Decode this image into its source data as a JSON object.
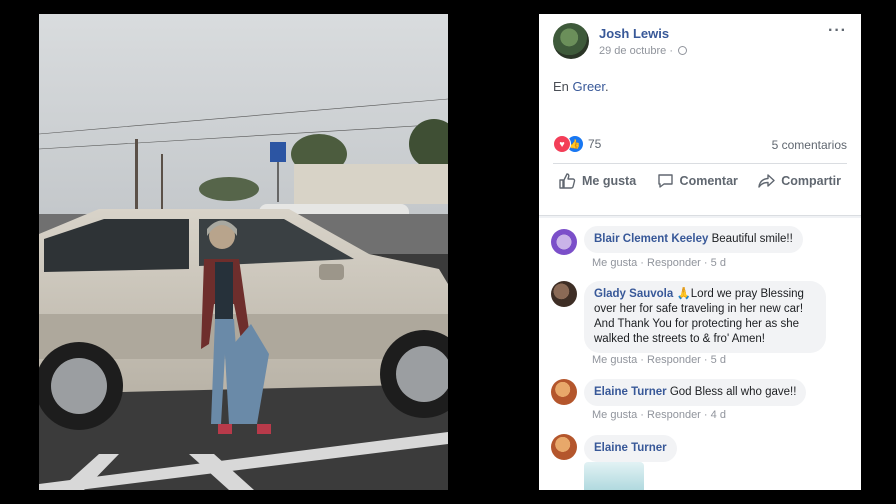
{
  "post": {
    "author": "Josh Lewis",
    "date": "29 de octubre ·",
    "more": "···",
    "location_prefix": "En ",
    "location": "Greer",
    "location_suffix": ".",
    "reaction_count": "75",
    "comments_count": "5 comentarios",
    "actions": {
      "like": "Me gusta",
      "comment": "Comentar",
      "share": "Compartir"
    }
  },
  "comments": [
    {
      "name": "Blair Clement Keeley",
      "text": " Beautiful smile!!",
      "like": "Me gusta",
      "dot": " · ",
      "reply": "Responder",
      "time": "5 d"
    },
    {
      "name": "Glady Sauvola",
      "text": " 🙏Lord we pray Blessing over her for safe traveling in her new car! And Thank You for protecting her as she walked the streets to & fro' Amen!",
      "like": "Me gusta",
      "dot": " · ",
      "reply": "Responder",
      "time": "5 d"
    },
    {
      "name": "Elaine Turner",
      "text": " God Bless all who gave!!",
      "like": "Me gusta",
      "dot": " · ",
      "reply": "Responder",
      "time": "4 d"
    },
    {
      "name": "Elaine Turner"
    }
  ],
  "colors": {
    "link": "#385898",
    "meta": "#90949c",
    "bubble": "#f2f3f5",
    "love": "#f33e58",
    "like": "#1877f2"
  },
  "icons": [
    "globe-icon",
    "more-icon",
    "love-reaction-icon",
    "like-reaction-icon",
    "thumbs-up-icon",
    "comment-icon",
    "share-icon"
  ]
}
